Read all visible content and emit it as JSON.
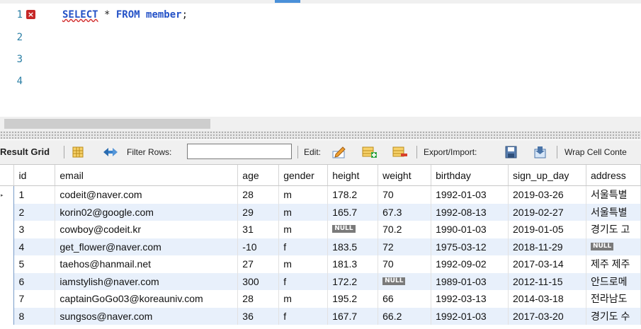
{
  "editor": {
    "line_numbers": [
      "1",
      "2",
      "3",
      "4"
    ],
    "error_badge": "×",
    "query": {
      "keyword1": "SELECT",
      "middle": " * ",
      "keyword2": "FROM",
      "table": " member",
      "terminator": ";"
    }
  },
  "toolbar": {
    "result_grid_label": "Result Grid",
    "filter_rows_label": "Filter Rows:",
    "filter_rows_value": "",
    "edit_label": "Edit:",
    "export_import_label": "Export/Import:",
    "wrap_cell_label": "Wrap Cell Conte"
  },
  "grid": {
    "null_label": "NULL",
    "columns": [
      "id",
      "email",
      "age",
      "gender",
      "height",
      "weight",
      "birthday",
      "sign_up_day",
      "address"
    ],
    "rows": [
      [
        "1",
        "codeit@naver.com",
        "28",
        "m",
        "178.2",
        "70",
        "1992-01-03",
        "2019-03-26",
        "서울특별"
      ],
      [
        "2",
        "korin02@google.com",
        "29",
        "m",
        "165.7",
        "67.3",
        "1992-08-13",
        "2019-02-27",
        "서울특별"
      ],
      [
        "3",
        "cowboy@codeit.kr",
        "31",
        "m",
        null,
        "70.2",
        "1990-01-03",
        "2019-01-05",
        "경기도 고"
      ],
      [
        "4",
        "get_flower@naver.com",
        "-10",
        "f",
        "183.5",
        "72",
        "1975-03-12",
        "2018-11-29",
        null
      ],
      [
        "5",
        "taehos@hanmail.net",
        "27",
        "m",
        "181.3",
        "70",
        "1992-09-02",
        "2017-03-14",
        "제주 제주"
      ],
      [
        "6",
        "iamstylish@naver.com",
        "300",
        "f",
        "172.2",
        null,
        "1989-01-03",
        "2012-11-15",
        "안드로메"
      ],
      [
        "7",
        "captainGoGo03@koreauniv.com",
        "28",
        "m",
        "195.2",
        "66",
        "1992-03-13",
        "2014-03-18",
        "전라남도"
      ],
      [
        "8",
        "sungsos@naver.com",
        "36",
        "f",
        "167.7",
        "66.2",
        "1992-01-03",
        "2017-03-20",
        "경기도 수"
      ]
    ]
  }
}
